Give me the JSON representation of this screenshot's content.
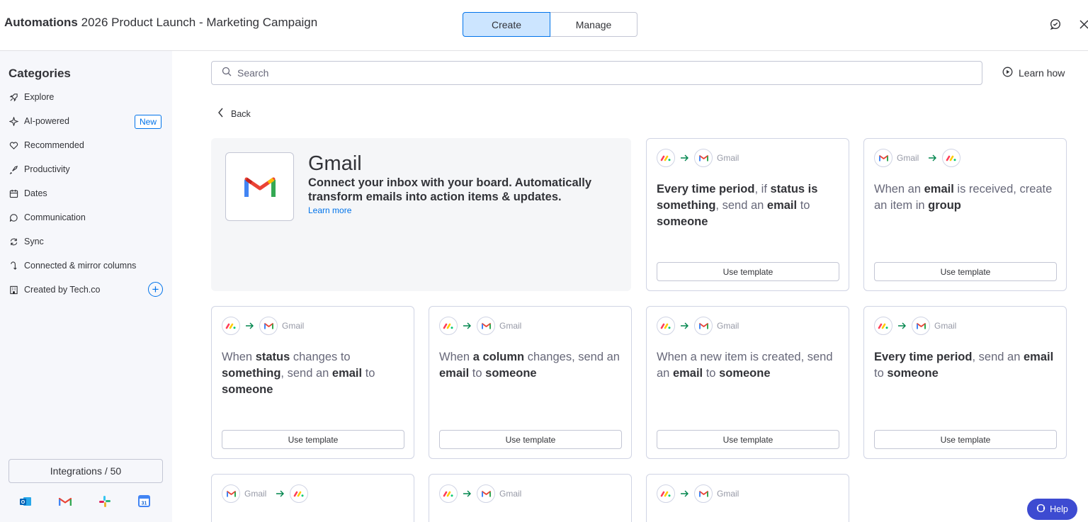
{
  "header": {
    "app_name": "Automations",
    "board_name": "2026 Product Launch - Marketing Campaign",
    "tabs": [
      {
        "label": "Create",
        "active": true
      },
      {
        "label": "Manage",
        "active": false
      }
    ],
    "icons": [
      "feedback-icon",
      "close-icon"
    ]
  },
  "sidebar": {
    "title": "Categories",
    "items": [
      {
        "label": "Explore",
        "icon": "rocket-icon"
      },
      {
        "label": "AI-powered",
        "icon": "sparkle-icon",
        "badge": "New"
      },
      {
        "label": "Recommended",
        "icon": "heart-icon"
      },
      {
        "label": "Productivity",
        "icon": "rocket-launch-icon"
      },
      {
        "label": "Dates",
        "icon": "calendar-icon"
      },
      {
        "label": "Communication",
        "icon": "chat-bubble-icon"
      },
      {
        "label": "Sync",
        "icon": "sync-icon"
      },
      {
        "label": "Connected & mirror columns",
        "icon": "connect-icon"
      },
      {
        "label": "Created by Tech.co",
        "icon": "building-icon"
      }
    ],
    "integrations_label": "Integrations / 50",
    "integration_icons": [
      "outlook-icon",
      "gmail-icon",
      "slack-icon",
      "google-calendar-icon"
    ]
  },
  "main": {
    "search_placeholder": "Search",
    "learn_how": "Learn how",
    "back_label": "Back",
    "hero": {
      "title": "Gmail",
      "description": "Connect your inbox with your board. Automatically transform emails into action items & updates.",
      "link": "Learn more"
    },
    "cards": [
      {
        "from": "monday",
        "to": "Gmail",
        "text_html": "<b>Every time period</b>, if <b>status is something</b>, send an <b>email</b> to <b>someone</b>",
        "button": "Use template"
      },
      {
        "from": "Gmail",
        "to": "monday",
        "text_html": "When an <b>email</b> is received, create an item in <b>group</b>",
        "button": "Use template"
      },
      {
        "from": "monday",
        "to": "Gmail",
        "text_html": "When <b>status</b> changes to <b>something</b>, send an <b>email</b> to <b>someone</b>",
        "button": "Use template"
      },
      {
        "from": "monday",
        "to": "Gmail",
        "text_html": "When <b>a column</b> changes, send an <b>email</b> to <b>someone</b>",
        "button": "Use template"
      },
      {
        "from": "monday",
        "to": "Gmail",
        "text_html": "When a new item is created, send an <b>email</b> to <b>someone</b>",
        "button": "Use template"
      },
      {
        "from": "monday",
        "to": "Gmail",
        "text_html": "<b>Every time period</b>, send an <b>email</b> to <b>someone</b>",
        "button": "Use template"
      },
      {
        "from": "Gmail",
        "to": "monday",
        "text_html": "",
        "button": ""
      },
      {
        "from": "monday",
        "to": "Gmail",
        "text_html": "",
        "button": ""
      },
      {
        "from": "monday",
        "to": "Gmail",
        "text_html": "",
        "button": ""
      }
    ],
    "help_label": "Help"
  },
  "colors": {
    "accent": "#0073ea",
    "active_tab_bg": "#cce5ff",
    "sidebar_bg": "#f6f7fb",
    "hero_bg": "#f5f6f8",
    "help_bg": "#3d4bd1",
    "arrow": "#00854d"
  }
}
